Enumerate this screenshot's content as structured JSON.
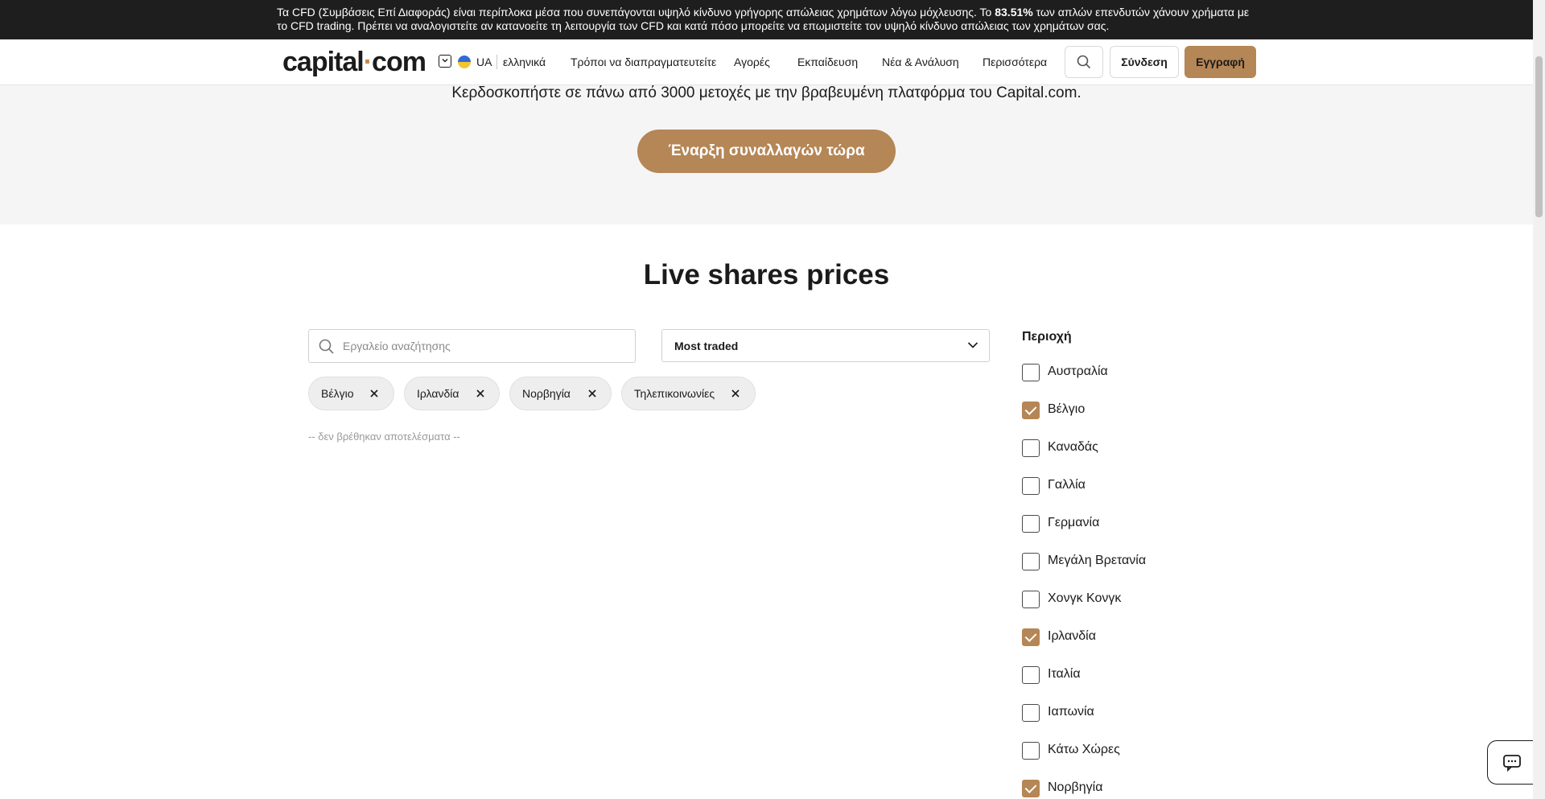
{
  "risk_warning": {
    "text_before": "Τα CFD (Συμβάσεις Επί Διαφοράς) είναι περίπλοκα μέσα που συνεπάγονται υψηλό κίνδυνο γρήγορης απώλειας χρημάτων λόγω μόχλευσης. Το ",
    "percent": "83.51%",
    "text_after": " των απλών επενδυτών χάνουν χρήματα με το CFD trading. Πρέπει να αναλογιστείτε αν κατανοείτε τη λειτουργία των CFD και κατά πόσο μπορείτε να επωμιστείτε τον υψηλό κίνδυνο απώλειας των χρημάτων σας."
  },
  "nav": {
    "logo_left": "capital",
    "logo_dot": "·",
    "logo_right": "com",
    "region_code": "UA",
    "language": "ελληνικά",
    "links": [
      "Τρόποι να διαπραγματευτείτε",
      "Αγορές",
      "Εκπαίδευση",
      "Νέα & Ανάλυση",
      "Περισσότερα"
    ],
    "login_label": "Σύνδεση",
    "signup_label": "Εγγραφή",
    "accent_color": "#b58656"
  },
  "hero": {
    "text": "Κερδοσκοπήστε σε πάνω από 3000 μετοχές με την βραβευμένη πλατφόρμα του Capital.com.",
    "cta_label": "Έναρξη συναλλαγών τώρα"
  },
  "section": {
    "title": "Live shares prices"
  },
  "search": {
    "placeholder": "Εργαλείο αναζήτησης",
    "value": ""
  },
  "sort": {
    "selected": "Most traded"
  },
  "active_filters": [
    "Βέλγιο",
    "Ιρλανδία",
    "Νορβηγία",
    "Τηλεπικοινωνίες"
  ],
  "no_results_text": "-- δεν βρέθηκαν αποτελέσματα --",
  "region_filter": {
    "title": "Περιοχή",
    "options": [
      {
        "label": "Αυστραλία",
        "checked": false
      },
      {
        "label": "Βέλγιο",
        "checked": true
      },
      {
        "label": "Καναδάς",
        "checked": false
      },
      {
        "label": "Γαλλία",
        "checked": false
      },
      {
        "label": "Γερμανία",
        "checked": false
      },
      {
        "label": "Μεγάλη Βρετανία",
        "checked": false
      },
      {
        "label": "Χονγκ Κονγκ",
        "checked": false
      },
      {
        "label": "Ιρλανδία",
        "checked": true
      },
      {
        "label": "Ιταλία",
        "checked": false
      },
      {
        "label": "Ιαπωνία",
        "checked": false
      },
      {
        "label": "Κάτω Χώρες",
        "checked": false
      },
      {
        "label": "Νορβηγία",
        "checked": true
      }
    ]
  },
  "icons": {
    "search": "search-icon",
    "chevron": "chevron-down-icon",
    "close": "close-icon",
    "chat": "chat-icon",
    "flag": "flag-icon"
  }
}
